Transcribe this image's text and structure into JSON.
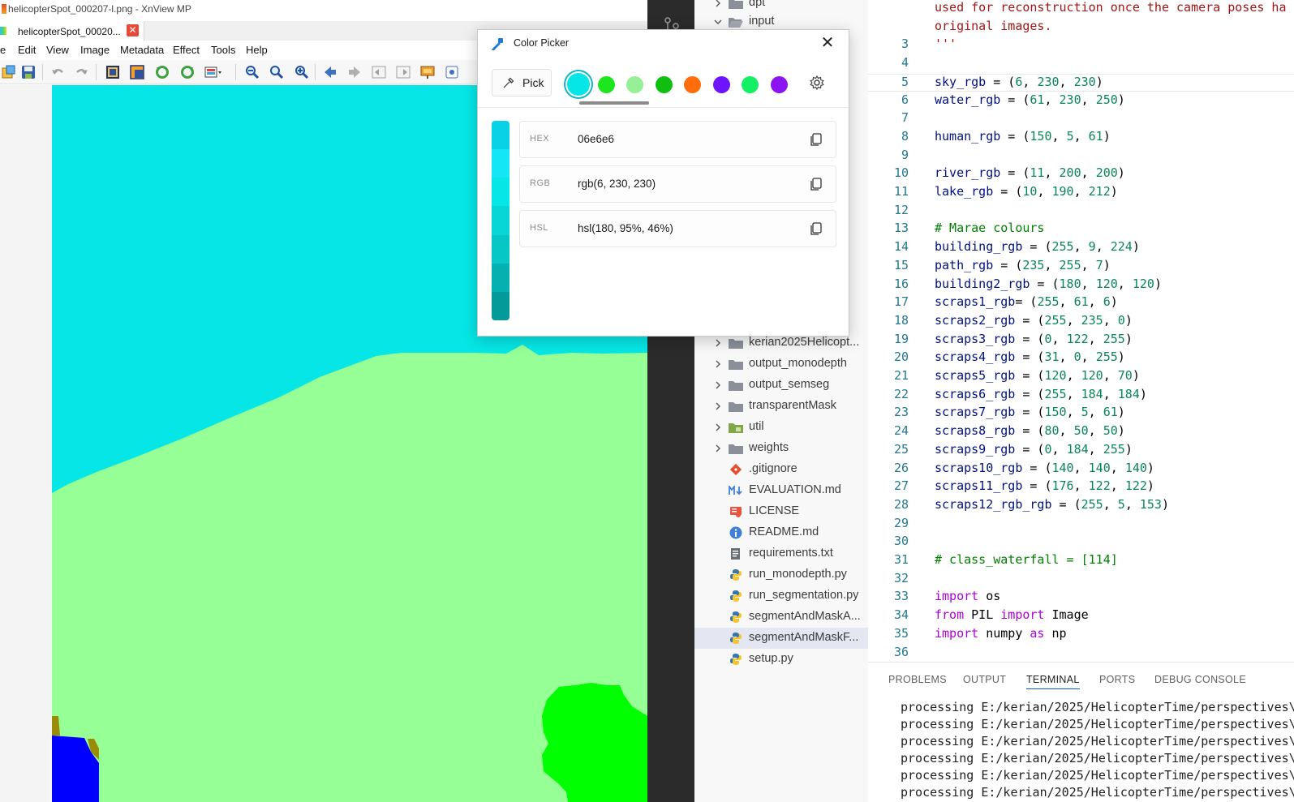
{
  "xnview": {
    "window_title": "helicopterSpot_000207-l.png - XnView MP",
    "tab_label": "helicopterSpot_00020...",
    "tab_close": "✕",
    "menus": [
      "e",
      "Edit",
      "View",
      "Image",
      "Metadata",
      "Effect",
      "Tools",
      "Help"
    ],
    "image_colors": {
      "sky": "#06e6e6",
      "ground": "#96ff96",
      "tree": "#00ff00",
      "blue": "#0000ff",
      "olive": "#9b8c05"
    }
  },
  "explorer": {
    "items": [
      {
        "label": "dpt",
        "type": "folder",
        "expanded": false
      },
      {
        "label": "input",
        "type": "folder",
        "expanded": true
      },
      {
        "label": "kerian2025Helicopt...",
        "type": "folder",
        "expanded": false
      },
      {
        "label": "output_monodepth",
        "type": "folder",
        "expanded": false
      },
      {
        "label": "output_semseg",
        "type": "folder",
        "expanded": false
      },
      {
        "label": "transparentMask",
        "type": "folder",
        "expanded": false
      },
      {
        "label": "util",
        "type": "folder",
        "expanded": false
      },
      {
        "label": "weights",
        "type": "folder",
        "expanded": false
      },
      {
        "label": ".gitignore",
        "type": "git"
      },
      {
        "label": "EVALUATION.md",
        "type": "md"
      },
      {
        "label": "LICENSE",
        "type": "license"
      },
      {
        "label": "README.md",
        "type": "info"
      },
      {
        "label": "requirements.txt",
        "type": "txt"
      },
      {
        "label": "run_monodepth.py",
        "type": "py"
      },
      {
        "label": "run_segmentation.py",
        "type": "py"
      },
      {
        "label": "segmentAndMaskA...",
        "type": "py"
      },
      {
        "label": "segmentAndMaskF...",
        "type": "py",
        "selected": true
      },
      {
        "label": "setup.py",
        "type": "py"
      }
    ],
    "truncated_marker": "..."
  },
  "editor": {
    "lines": [
      {
        "n": "",
        "tokens": [
          [
            "used for reconstruction once the camera poses ha",
            "red"
          ]
        ]
      },
      {
        "n": "",
        "tokens": [
          [
            "original images.",
            "red"
          ]
        ]
      },
      {
        "n": "3",
        "tokens": [
          [
            "'''",
            "red"
          ]
        ]
      },
      {
        "n": "4",
        "tokens": []
      },
      {
        "n": "5",
        "current": true,
        "tokens": [
          [
            "sky_rgb",
            "var"
          ],
          [
            " = (",
            "def"
          ],
          [
            "6",
            "num"
          ],
          [
            ", ",
            "def"
          ],
          [
            "230",
            "num"
          ],
          [
            ", ",
            "def"
          ],
          [
            "230",
            "num"
          ],
          [
            ")",
            "def"
          ]
        ]
      },
      {
        "n": "6",
        "tokens": [
          [
            "water_rgb",
            "var"
          ],
          [
            " = (",
            "def"
          ],
          [
            "61",
            "num"
          ],
          [
            ", ",
            "def"
          ],
          [
            "230",
            "num"
          ],
          [
            ", ",
            "def"
          ],
          [
            "250",
            "num"
          ],
          [
            ")",
            "def"
          ]
        ]
      },
      {
        "n": "7",
        "tokens": []
      },
      {
        "n": "8",
        "tokens": [
          [
            "human_rgb",
            "var"
          ],
          [
            " = (",
            "def"
          ],
          [
            "150",
            "num"
          ],
          [
            ", ",
            "def"
          ],
          [
            "5",
            "num"
          ],
          [
            ", ",
            "def"
          ],
          [
            "61",
            "num"
          ],
          [
            ")",
            "def"
          ]
        ]
      },
      {
        "n": "9",
        "tokens": []
      },
      {
        "n": "10",
        "tokens": [
          [
            "river_rgb",
            "var"
          ],
          [
            " = (",
            "def"
          ],
          [
            "11",
            "num"
          ],
          [
            ", ",
            "def"
          ],
          [
            "200",
            "num"
          ],
          [
            ", ",
            "def"
          ],
          [
            "200",
            "num"
          ],
          [
            ")",
            "def"
          ]
        ]
      },
      {
        "n": "11",
        "tokens": [
          [
            "lake_rgb",
            "var"
          ],
          [
            " = (",
            "def"
          ],
          [
            "10",
            "num"
          ],
          [
            ", ",
            "def"
          ],
          [
            "190",
            "num"
          ],
          [
            ", ",
            "def"
          ],
          [
            "212",
            "num"
          ],
          [
            ")",
            "def"
          ]
        ]
      },
      {
        "n": "12",
        "tokens": []
      },
      {
        "n": "13",
        "tokens": [
          [
            "# Marae colours",
            "cmt"
          ]
        ]
      },
      {
        "n": "14",
        "tokens": [
          [
            "building_rgb",
            "var"
          ],
          [
            " = (",
            "def"
          ],
          [
            "255",
            "num"
          ],
          [
            ", ",
            "def"
          ],
          [
            "9",
            "num"
          ],
          [
            ", ",
            "def"
          ],
          [
            "224",
            "num"
          ],
          [
            ")",
            "def"
          ]
        ]
      },
      {
        "n": "15",
        "tokens": [
          [
            "path_rgb",
            "var"
          ],
          [
            " = (",
            "def"
          ],
          [
            "235",
            "num"
          ],
          [
            ", ",
            "def"
          ],
          [
            "255",
            "num"
          ],
          [
            ", ",
            "def"
          ],
          [
            "7",
            "num"
          ],
          [
            ")",
            "def"
          ]
        ]
      },
      {
        "n": "16",
        "tokens": [
          [
            "building2_rgb",
            "var"
          ],
          [
            " = (",
            "def"
          ],
          [
            "180",
            "num"
          ],
          [
            ", ",
            "def"
          ],
          [
            "120",
            "num"
          ],
          [
            ", ",
            "def"
          ],
          [
            "120",
            "num"
          ],
          [
            ")",
            "def"
          ]
        ]
      },
      {
        "n": "17",
        "tokens": [
          [
            "scraps1_rgb",
            "var"
          ],
          [
            "= (",
            "def"
          ],
          [
            "255",
            "num"
          ],
          [
            ", ",
            "def"
          ],
          [
            "61",
            "num"
          ],
          [
            ", ",
            "def"
          ],
          [
            "6",
            "num"
          ],
          [
            ")",
            "def"
          ]
        ]
      },
      {
        "n": "18",
        "tokens": [
          [
            "scraps2_rgb",
            "var"
          ],
          [
            " = (",
            "def"
          ],
          [
            "255",
            "num"
          ],
          [
            ", ",
            "def"
          ],
          [
            "235",
            "num"
          ],
          [
            ", ",
            "def"
          ],
          [
            "0",
            "num"
          ],
          [
            ")",
            "def"
          ]
        ]
      },
      {
        "n": "19",
        "tokens": [
          [
            "scraps3_rgb",
            "var"
          ],
          [
            " = (",
            "def"
          ],
          [
            "0",
            "num"
          ],
          [
            ", ",
            "def"
          ],
          [
            "122",
            "num"
          ],
          [
            ", ",
            "def"
          ],
          [
            "255",
            "num"
          ],
          [
            ")",
            "def"
          ]
        ]
      },
      {
        "n": "20",
        "tokens": [
          [
            "scraps4_rgb",
            "var"
          ],
          [
            " = (",
            "def"
          ],
          [
            "31",
            "num"
          ],
          [
            ", ",
            "def"
          ],
          [
            "0",
            "num"
          ],
          [
            ", ",
            "def"
          ],
          [
            "255",
            "num"
          ],
          [
            ")",
            "def"
          ]
        ]
      },
      {
        "n": "21",
        "tokens": [
          [
            "scraps5_rgb",
            "var"
          ],
          [
            " = (",
            "def"
          ],
          [
            "120",
            "num"
          ],
          [
            ", ",
            "def"
          ],
          [
            "120",
            "num"
          ],
          [
            ", ",
            "def"
          ],
          [
            "70",
            "num"
          ],
          [
            ")",
            "def"
          ]
        ]
      },
      {
        "n": "22",
        "tokens": [
          [
            "scraps6_rgb",
            "var"
          ],
          [
            " = (",
            "def"
          ],
          [
            "255",
            "num"
          ],
          [
            ", ",
            "def"
          ],
          [
            "184",
            "num"
          ],
          [
            ", ",
            "def"
          ],
          [
            "184",
            "num"
          ],
          [
            ")",
            "def"
          ]
        ]
      },
      {
        "n": "23",
        "tokens": [
          [
            "scraps7_rgb",
            "var"
          ],
          [
            " = (",
            "def"
          ],
          [
            "150",
            "num"
          ],
          [
            ", ",
            "def"
          ],
          [
            "5",
            "num"
          ],
          [
            ", ",
            "def"
          ],
          [
            "61",
            "num"
          ],
          [
            ")",
            "def"
          ]
        ]
      },
      {
        "n": "24",
        "tokens": [
          [
            "scraps8_rgb",
            "var"
          ],
          [
            " = (",
            "def"
          ],
          [
            "80",
            "num"
          ],
          [
            ", ",
            "def"
          ],
          [
            "50",
            "num"
          ],
          [
            ", ",
            "def"
          ],
          [
            "50",
            "num"
          ],
          [
            ")",
            "def"
          ]
        ]
      },
      {
        "n": "25",
        "tokens": [
          [
            "scraps9_rgb",
            "var"
          ],
          [
            " = (",
            "def"
          ],
          [
            "0",
            "num"
          ],
          [
            ", ",
            "def"
          ],
          [
            "184",
            "num"
          ],
          [
            ", ",
            "def"
          ],
          [
            "255",
            "num"
          ],
          [
            ")",
            "def"
          ]
        ]
      },
      {
        "n": "26",
        "tokens": [
          [
            "scraps10_rgb",
            "var"
          ],
          [
            " = (",
            "def"
          ],
          [
            "140",
            "num"
          ],
          [
            ", ",
            "def"
          ],
          [
            "140",
            "num"
          ],
          [
            ", ",
            "def"
          ],
          [
            "140",
            "num"
          ],
          [
            ")",
            "def"
          ]
        ]
      },
      {
        "n": "27",
        "tokens": [
          [
            "scraps11_rgb",
            "var"
          ],
          [
            " = (",
            "def"
          ],
          [
            "176",
            "num"
          ],
          [
            ", ",
            "def"
          ],
          [
            "122",
            "num"
          ],
          [
            ", ",
            "def"
          ],
          [
            "122",
            "num"
          ],
          [
            ")",
            "def"
          ]
        ]
      },
      {
        "n": "28",
        "tokens": [
          [
            "scraps12_rgb_rgb",
            "var"
          ],
          [
            " = (",
            "def"
          ],
          [
            "255",
            "num"
          ],
          [
            ", ",
            "def"
          ],
          [
            "5",
            "num"
          ],
          [
            ", ",
            "def"
          ],
          [
            "153",
            "num"
          ],
          [
            ")",
            "def"
          ]
        ]
      },
      {
        "n": "29",
        "tokens": []
      },
      {
        "n": "30",
        "tokens": []
      },
      {
        "n": "31",
        "tokens": [
          [
            "# class_waterfall = [114]",
            "cmt"
          ]
        ]
      },
      {
        "n": "32",
        "tokens": []
      },
      {
        "n": "33",
        "tokens": [
          [
            "import",
            "kw2"
          ],
          [
            " os",
            "def"
          ]
        ]
      },
      {
        "n": "34",
        "tokens": [
          [
            "from",
            "kw2"
          ],
          [
            " PIL ",
            "def"
          ],
          [
            "import",
            "kw2"
          ],
          [
            " Image",
            "def"
          ]
        ]
      },
      {
        "n": "35",
        "tokens": [
          [
            "import",
            "kw2"
          ],
          [
            " numpy ",
            "def"
          ],
          [
            "as",
            "kw2"
          ],
          [
            " np",
            "def"
          ]
        ]
      },
      {
        "n": "36",
        "tokens": []
      }
    ]
  },
  "panel": {
    "tabs": [
      {
        "label": "PROBLEMS",
        "active": false
      },
      {
        "label": "OUTPUT",
        "active": false
      },
      {
        "label": "TERMINAL",
        "active": true
      },
      {
        "label": "PORTS",
        "active": false
      },
      {
        "label": "DEBUG CONSOLE",
        "active": false
      }
    ],
    "terminal_lines": [
      "processing E:/kerian/2025/HelicopterTime/perspectives\\",
      "processing E:/kerian/2025/HelicopterTime/perspectives\\",
      "processing E:/kerian/2025/HelicopterTime/perspectives\\",
      "processing E:/kerian/2025/HelicopterTime/perspectives\\",
      "processing E:/kerian/2025/HelicopterTime/perspectives\\",
      "processing E:/kerian/2025/HelicopterTime/perspectives\\"
    ]
  },
  "color_picker": {
    "title": "Color Picker",
    "close_glyph": "✕",
    "pick_label": "Pick",
    "swatches": [
      "#06e6e6",
      "#1ee61e",
      "#96f096",
      "#0fbe0f",
      "#ff6e0a",
      "#6e14ff",
      "#14f064",
      "#8c14f0"
    ],
    "selected_swatch": 0,
    "shade_bar": [
      "#0ad2e6",
      "#14e6f6",
      "#06e6e6",
      "#06d6d6",
      "#06c6c6",
      "#05b0b0",
      "#049a9a"
    ],
    "formats": [
      {
        "key": "HEX",
        "value": "06e6e6"
      },
      {
        "key": "RGB",
        "value": "rgb(6, 230, 230)"
      },
      {
        "key": "HSL",
        "value": "hsl(180, 95%, 46%)"
      }
    ]
  }
}
